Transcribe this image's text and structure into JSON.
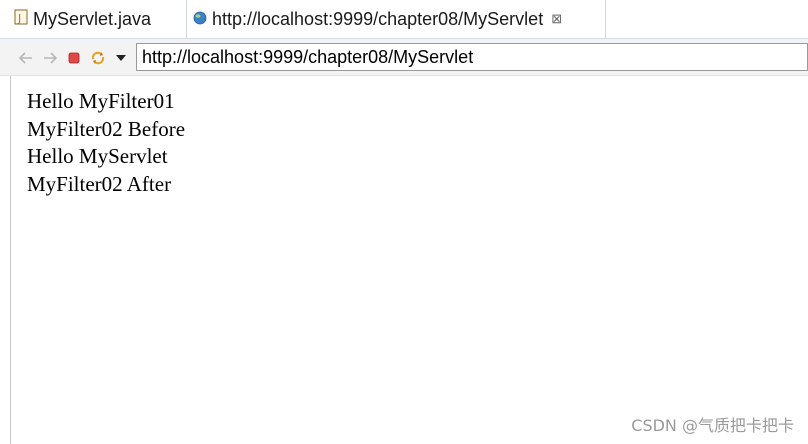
{
  "tabs": [
    {
      "label": "MyServlet.java"
    },
    {
      "label": "http://localhost:9999/chapter08/MyServlet",
      "close": "⊠"
    }
  ],
  "address_bar": {
    "value": "http://localhost:9999/chapter08/MyServlet"
  },
  "page": {
    "lines": [
      "Hello MyFilter01",
      "MyFilter02 Before",
      "Hello MyServlet",
      "MyFilter02 After"
    ]
  },
  "watermark": "CSDN @气质把卡把卡",
  "icons": {
    "back": "back-arrow-icon",
    "forward": "forward-arrow-icon",
    "stop": "stop-icon",
    "refresh": "refresh-icon",
    "menu": "dropdown-triangle-icon"
  },
  "colors": {
    "stop": "#e04848",
    "refresh": "#e8a020",
    "globe": "#3a82c4"
  }
}
